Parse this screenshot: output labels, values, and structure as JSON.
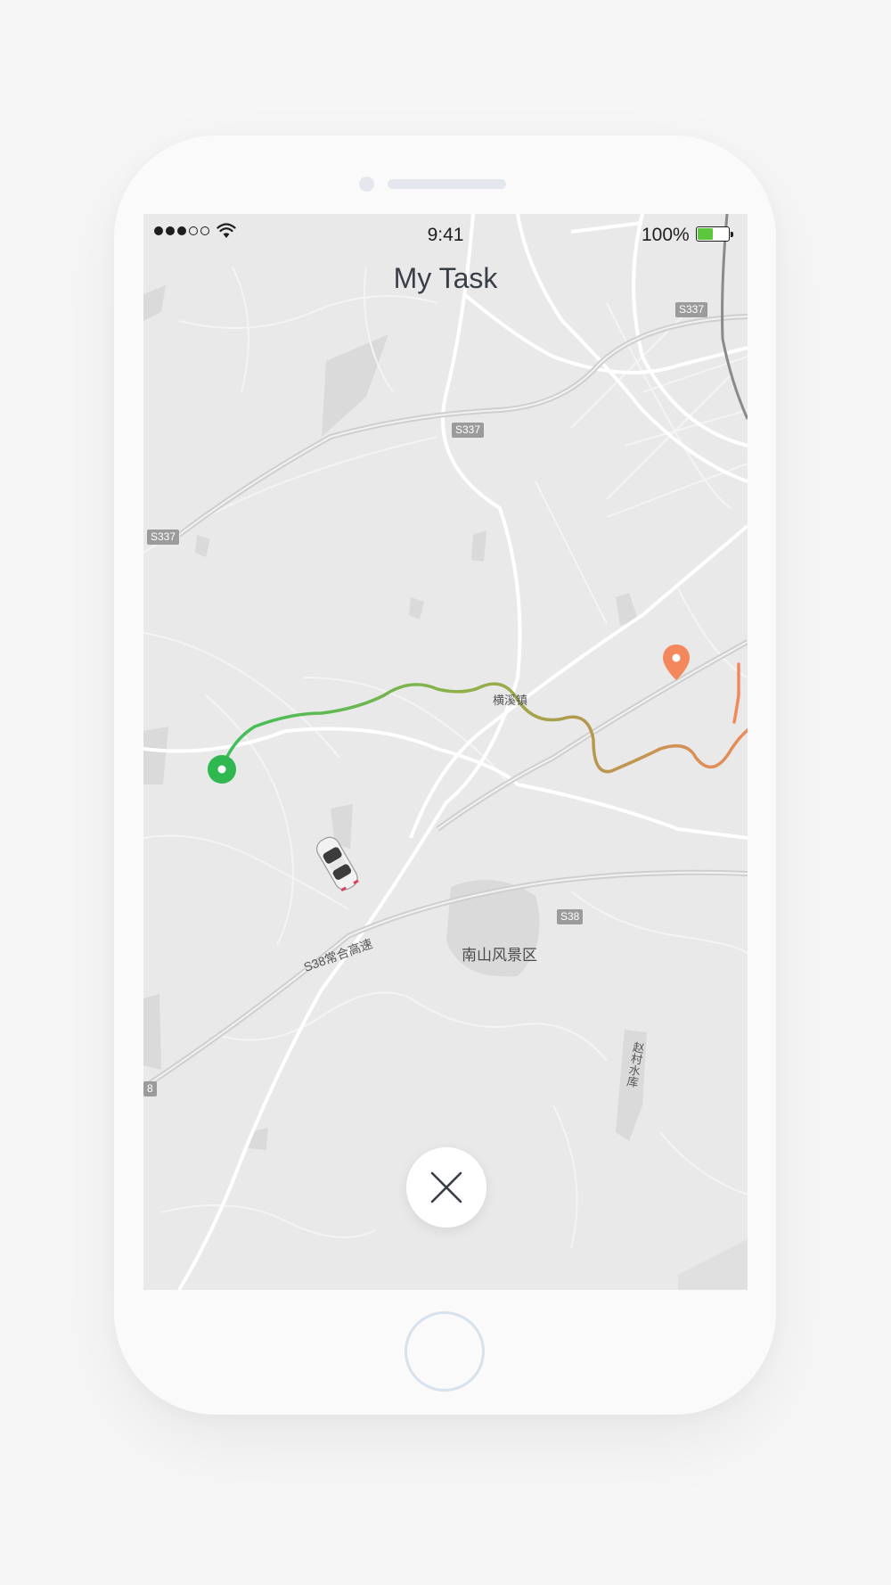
{
  "status_bar": {
    "time": "9:41",
    "battery_percent_text": "100%",
    "battery_level": 0.5,
    "signal_bars_filled": 3,
    "signal_bars_total": 5
  },
  "header": {
    "title": "My Task"
  },
  "map": {
    "road_labels": [
      "S337",
      "S337",
      "S337",
      "S38",
      "8"
    ],
    "place_labels": {
      "town": "横溪镇",
      "scenic_area": "南山风景区",
      "expressway": "S38常合高速",
      "reservoir": "赵村水库"
    },
    "route": {
      "start_color": "#3dbf5a",
      "end_color": "#f08a5d"
    },
    "icons": {
      "start": "start-location-pin-icon",
      "end": "destination-pin-icon",
      "vehicle": "car-icon"
    }
  },
  "actions": {
    "close_icon": "close-icon"
  },
  "colors": {
    "title": "#3a3e48",
    "map_bg": "#e9e9e9",
    "phone_body": "#fafafa"
  }
}
